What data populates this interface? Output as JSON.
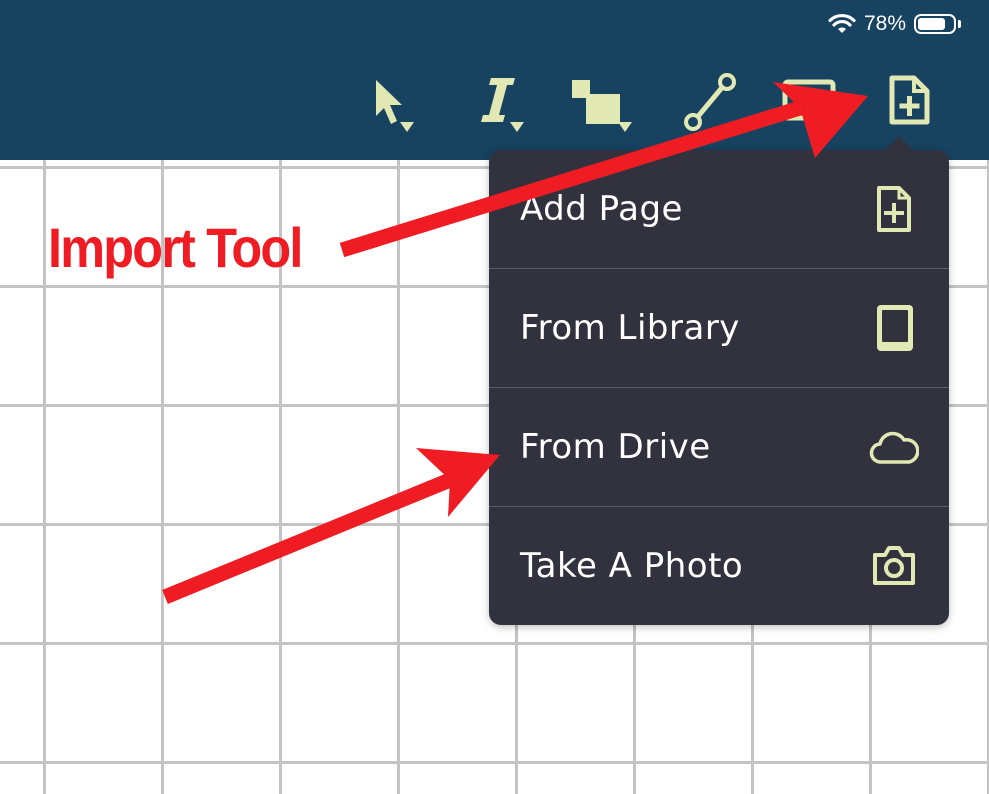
{
  "status_bar": {
    "battery_text": "78%",
    "battery_level": 0.78,
    "icons": [
      "wifi-icon",
      "battery-icon"
    ]
  },
  "toolbar": {
    "tools": [
      {
        "name": "select-tool",
        "icon": "cursor-arrow-icon",
        "has_dropdown": true
      },
      {
        "name": "text-tool",
        "icon": "italic-i-icon",
        "has_dropdown": true
      },
      {
        "name": "shape-tool",
        "icon": "squares-icon",
        "has_dropdown": true
      },
      {
        "name": "line-tool",
        "icon": "line-segment-icon",
        "has_dropdown": false
      },
      {
        "name": "text-box-tool",
        "icon": "text-box-icon",
        "has_dropdown": false
      },
      {
        "name": "import-tool",
        "icon": "add-page-icon",
        "has_dropdown": false
      }
    ]
  },
  "import_menu": {
    "items": [
      {
        "label": "Add Page",
        "icon": "add-page-icon"
      },
      {
        "label": "From Library",
        "icon": "tablet-icon"
      },
      {
        "label": "From Drive",
        "icon": "cloud-icon"
      },
      {
        "label": "Take A Photo",
        "icon": "camera-icon"
      }
    ]
  },
  "annotation": {
    "label": "Import Tool",
    "color": "#ef1c24"
  },
  "colors": {
    "topbar": "#174260",
    "menu_bg": "#31323e",
    "accent": "#e2e8b4",
    "grid_line": "#c4c4c4"
  }
}
